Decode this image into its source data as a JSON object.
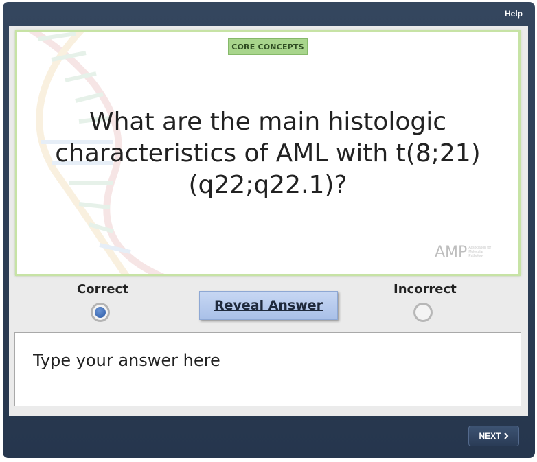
{
  "header": {
    "help_label": "Help"
  },
  "card": {
    "badge": "CORE CONCEPTS",
    "question": "What are the main histologic characteristics of AML with t(8;21) (q22;q22.1)?",
    "logo": {
      "text": "AMP",
      "subtext": "Association for Molecular Pathology"
    }
  },
  "choices": {
    "correct_label": "Correct",
    "incorrect_label": "Incorrect",
    "selected": "Correct"
  },
  "reveal_label": "Reveal Answer",
  "answer": {
    "placeholder": "Type your answer here",
    "value": ""
  },
  "footer": {
    "next_label": "NEXT",
    "next_icon": "chevron-right-icon"
  }
}
